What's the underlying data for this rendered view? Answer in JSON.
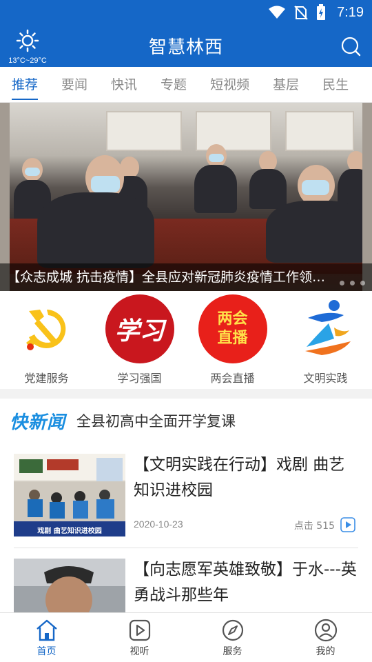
{
  "status_bar": {
    "time": "7:19",
    "icons": [
      "wifi-icon",
      "no-sim-icon",
      "battery-icon"
    ]
  },
  "header": {
    "title": "智慧林西",
    "weather": {
      "icon": "sun-icon",
      "temp": "13°C~29°C"
    },
    "search_icon": "search-icon"
  },
  "tabs": [
    {
      "label": "推荐",
      "active": true
    },
    {
      "label": "要闻"
    },
    {
      "label": "快讯"
    },
    {
      "label": "专题"
    },
    {
      "label": "短视频"
    },
    {
      "label": "基层"
    },
    {
      "label": "民生"
    }
  ],
  "banner": {
    "caption": "【众志成城 抗击疫情】全县应对新冠肺炎疫情工作领导..."
  },
  "quick_links": [
    {
      "label": "党建服务",
      "icon": "party-emblem-icon"
    },
    {
      "label": "学习强国",
      "icon": "xuexi-logo-icon",
      "logo_text": "学习"
    },
    {
      "label": "两会直播",
      "icon": "two-sessions-logo-icon",
      "logo_text_1": "两会",
      "logo_text_2": "直播"
    },
    {
      "label": "文明实践",
      "icon": "civilization-logo-icon"
    }
  ],
  "ticker": {
    "logo": "快新闻",
    "text": "全县初高中全面开学复课"
  },
  "news": [
    {
      "title": "【文明实践在行动】戏剧 曲艺知识进校园",
      "date": "2020-10-23",
      "clicks": "点击 515",
      "thumb_caption": "戏剧 曲艺知识进校园"
    },
    {
      "title": "【向志愿军英雄致敬】于水---英勇战斗那些年"
    }
  ],
  "bottom_nav": [
    {
      "label": "首页",
      "icon": "home-icon",
      "active": true
    },
    {
      "label": "视听",
      "icon": "video-icon"
    },
    {
      "label": "服务",
      "icon": "compass-icon"
    },
    {
      "label": "我的",
      "icon": "user-icon"
    }
  ],
  "colors": {
    "brand": "#1567c7",
    "ticker_logo": "#1a8ee0",
    "party_red": "#e8300f",
    "xuexi_red": "#c9171e"
  }
}
